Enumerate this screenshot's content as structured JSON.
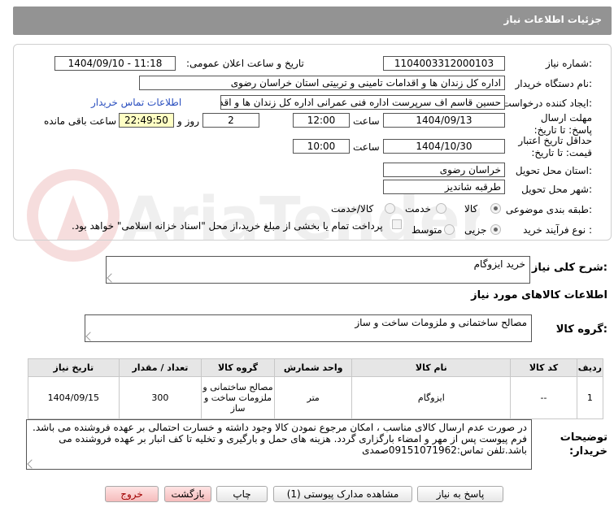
{
  "header": {
    "title": "جزئیات اطلاعات نیاز"
  },
  "form": {
    "need_number_label": "شماره نیاز:",
    "need_number": "1104003312000103",
    "announce_label": "تاریخ و ساعت اعلان عمومی:",
    "announce_value": "1404/09/10 - 11:18",
    "buyer_org_label": "نام دستگاه خریدار:",
    "buyer_org": "اداره کل زندان ها و اقدامات تامینی و تربیتی استان خراسان رضوی",
    "creator_label": "ایجاد کننده درخواست:",
    "creator": "حسین قاسم اف سرپرست اداره فنی عمرانی اداره کل زندان ها و اقدامات تامینی",
    "contact_link": "اطلاعات تماس خریدار",
    "send_deadline_label": "مهلت ارسال پاسخ: تا تاریخ:",
    "send_date": "1404/09/13",
    "time_label": "ساعت",
    "send_time": "12:00",
    "days_value": "2",
    "days_label": "روز و",
    "remaining_time": "22:49:50",
    "remaining_label": "ساعت باقی مانده",
    "price_validity_label": "حداقل تاریخ اعتبار قیمت: تا تاریخ:",
    "validity_date": "1404/10/30",
    "validity_time": "10:00",
    "province_label": "استان محل تحویل:",
    "province": "خراسان رضوی",
    "city_label": "شهر محل تحویل:",
    "city": "طرقبه شاندیز",
    "category_label": "طبقه بندی موضوعی:",
    "category_options": [
      "کالا",
      "خدمت",
      "کالا/خدمت"
    ],
    "process_label": "نوع فرآیند خرید :",
    "process_options": [
      "جزیی",
      "متوسط"
    ],
    "payment_note": "پرداخت تمام یا بخشی از مبلغ خرید،از محل \"اسناد خزانه اسلامی\" خواهد بود."
  },
  "need_desc": {
    "label": "شرح کلی نیاز:",
    "value": "خرید ایزوگام"
  },
  "goods_info": {
    "title": "اطلاعات کالاهای مورد نیاز"
  },
  "goods_group": {
    "label": "گروه کالا:",
    "value": "مصالح ساختمانی و ملزومات ساخت و ساز"
  },
  "table": {
    "headers": [
      "ردیف",
      "کد کالا",
      "نام کالا",
      "واحد شمارش",
      "گروه کالا",
      "تعداد / مقدار",
      "تاریخ نیاز"
    ],
    "rows": [
      [
        "1",
        "--",
        "ایزوگام",
        "متر",
        "مصالح ساختمانی و ملزومات ساخت و ساز",
        "300",
        "1404/09/15"
      ]
    ]
  },
  "buyer_notes": {
    "label": "توضیحات خریدار:",
    "value": "در صورت عدم  ارسال کالای مناسب  ،  امکان مرجوع نمودن کالا  وجود داشته و خسارت احتمالی بر عهده فروشنده می باشد. فرم پیوست پس از مهر و امضاء بارگزاری گردد. هزینه های حمل و بارگیری و تخلیه تا کف انبار بر عهده فروشنده می باشد.تلفن تماس:09151071962صمدی"
  },
  "buttons": {
    "reply": "پاسخ به نیاز",
    "attachments": "مشاهده مدارک پیوستی (1)",
    "print": "چاپ",
    "back": "بازگشت",
    "exit": "خروج"
  },
  "watermark": {
    "text": "AriaTender.neT"
  },
  "colors": {
    "header_bg": "#939393",
    "link": "#2a4fbf",
    "remaining_bg": "#ffffc4",
    "exit_bg": "#f5bcbc"
  }
}
